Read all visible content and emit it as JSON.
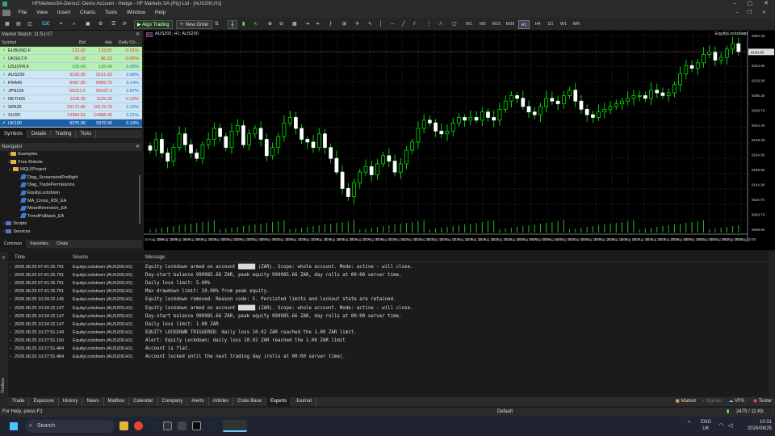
{
  "window": {
    "title": "HFMarketsSA-Demo2: Demo Account - Hedge - HF Markets SA (Pty) Ltd - [AUS200,H1]"
  },
  "menu": [
    "File",
    "View",
    "Insert",
    "Charts",
    "Tools",
    "Window",
    "Help"
  ],
  "toolbar": {
    "algo_trading": "Algo Trading",
    "new_order": "New Order",
    "ide": "IDE",
    "timeframes": [
      "M1",
      "M5",
      "M15",
      "M30",
      "H1",
      "H4",
      "D1",
      "W1",
      "MN"
    ],
    "active_timeframe": "H1"
  },
  "market_watch": {
    "title": "Market Watch: 11:51:07",
    "columns": [
      "Symbol",
      "Bid",
      "Ask",
      "Daily Ch..."
    ],
    "rows": [
      {
        "symbol": "EUBUND.F",
        "bid": "123.82",
        "ask": "123.87",
        "change": "-0.01%",
        "color": "#b6f0b0"
      },
      {
        "symbol": "UKGILT.F",
        "bid": "86.18",
        "ask": "86.23",
        "change": "-0.06%",
        "color": "#b6f0b0"
      },
      {
        "symbol": "US10YR.F",
        "bid": "105.43",
        "ask": "105.49",
        "change": "0.00%",
        "color": "#b6f0b0"
      },
      {
        "symbol": "AUS200",
        "bid": "9150.90",
        "ask": "9161.60",
        "change": "0.68%",
        "color": "#cce6f5"
      },
      {
        "symbol": "FRA40",
        "bid": "8487.80",
        "ask": "8489.70",
        "change": "0.14%",
        "color": "#cce6f5"
      },
      {
        "symbol": "JPN225",
        "bid": "65021.0",
        "ask": "65037.0",
        "change": "0.87%",
        "color": "#cce6f5"
      },
      {
        "symbol": "NETH25",
        "bid": "1108.30",
        "ask": "1109.30",
        "change": "-0.18%",
        "color": "#cce6f5"
      },
      {
        "symbol": "SPA35",
        "bid": "20172.80",
        "ask": "20176.70",
        "change": "0.33%",
        "color": "#cce6f5"
      },
      {
        "symbol": "SUI20",
        "bid": "14484.53",
        "ask": "14488.40",
        "change": "0.21%",
        "color": "#cce6f5"
      },
      {
        "symbol": "UK100",
        "bid": "9375.90",
        "ask": "9376.90",
        "change": "0.19%",
        "color": "#1a5fa8"
      }
    ],
    "tabs": [
      "Symbols",
      "Details",
      "Trading",
      "Ticks"
    ]
  },
  "navigator": {
    "title": "Navigator",
    "items": [
      {
        "label": "Examples",
        "level": 1
      },
      {
        "label": "Free Robots",
        "level": 1
      },
      {
        "label": "MQL5Project",
        "level": 1
      },
      {
        "label": "Diag_ScreenshotPreflight",
        "level": 2
      },
      {
        "label": "Diag_TradePermissions",
        "level": 2
      },
      {
        "label": "EquityLockdown",
        "level": 2
      },
      {
        "label": "MA_Cross_RSI_EA",
        "level": 2
      },
      {
        "label": "MeanReversion_EA",
        "level": 2
      },
      {
        "label": "TrendPullback_EA",
        "level": 2
      },
      {
        "label": "Scripts",
        "level": 0
      },
      {
        "label": "Services",
        "level": 0
      }
    ],
    "tabs": [
      "Common",
      "Favorites",
      "Chats"
    ]
  },
  "chart": {
    "symbol_label": "AUS200, H1: AUS200",
    "indicator_label": "EquityLockdown",
    "price_labels": [
      "9392.30",
      "9369.70",
      "9344.90",
      "9319.90",
      "9295.30",
      "9269.70",
      "9244.30",
      "9219.30",
      "9194.90",
      "9169.90",
      "9144.90",
      "9119.70",
      "9094.70",
      "9069.90"
    ],
    "time_labels": [
      "19 Aug 2026",
      "19 Aug 16:00",
      "19 Aug 18:00",
      "19 Aug 20:00",
      "19 Aug 22:00",
      "20 Aug 00:00",
      "20 Aug 02:00",
      "20 Aug 04:00",
      "20 Aug 06:00",
      "20 Aug 08:00",
      "20 Aug 10:00",
      "20 Aug 12:00",
      "20 Aug 14:00",
      "20 Aug 16:00",
      "20 Aug 18:00",
      "20 Aug 20:00",
      "20 Aug 22:00",
      "21 Aug 00:00",
      "21 Aug 02:00",
      "21 Aug 04:00",
      "21 Aug 06:00",
      "21 Aug 08:00",
      "21 Aug 10:00",
      "21 Aug 12:00",
      "21 Aug 14:00",
      "21 Aug 16:00",
      "21 Aug 18:00",
      "21 Aug 20:00",
      "21 Aug 22:00",
      "24 Aug 00:00",
      "24 Aug 02:00",
      "24 Aug 04:00",
      "24 Aug 06:00",
      "24 Aug 08:00",
      "24 Aug 10:00",
      "24 Aug 12:00",
      "24 Aug 14:00",
      "24 Aug 16:00",
      "24 Aug 18:00",
      "24 Aug 20:00",
      "24 Aug 22:00",
      "25 Aug 00:00",
      "25 Aug 02:00",
      "25 Aug 04:00",
      "25 Aug 06:00",
      "25 Aug 08:00",
      "25 Aug 10:00"
    ],
    "candles_close_trend": [
      9190,
      9210,
      9185,
      9170,
      9195,
      9220,
      9200,
      9185,
      9175,
      9200,
      9210,
      9230,
      9215,
      9195,
      9225,
      9235,
      9200,
      9220,
      9230,
      9210,
      9180,
      9195,
      9215,
      9240,
      9250,
      9230,
      9210,
      9205,
      9195,
      9220,
      9195,
      9175,
      9150,
      9120,
      9105,
      9130,
      9150,
      9160,
      9145,
      9165,
      9180,
      9170,
      9150,
      9165,
      9190,
      9205,
      9230,
      9245,
      9240,
      9225,
      9220,
      9225,
      9240,
      9250,
      9245,
      9250,
      9245,
      9260,
      9250,
      9245,
      9265,
      9280,
      9290,
      9285,
      9270,
      9260,
      9255,
      9270,
      9285,
      9280,
      9275,
      9290,
      9300,
      9280,
      9265,
      9255,
      9250,
      9260,
      9265,
      9270,
      9275,
      9280,
      9285,
      9290,
      9290,
      9285,
      9300,
      9295,
      9290,
      9295,
      9310,
      9330,
      9345,
      9340,
      9350,
      9365,
      9370,
      9355,
      9360,
      9375,
      9385,
      9370
    ]
  },
  "journal": {
    "columns": [
      "Time",
      "Source",
      "Message"
    ],
    "rows": [
      {
        "time": "2026.08.25 07:41:25.791",
        "source": "EquityLockdown (AUS200,H1)",
        "message": "Equity lockdown armed on account ██████ (ZAR). Scope: whole account. Mode: active - will close."
      },
      {
        "time": "2026.08.25 07:41:25.791",
        "source": "EquityLockdown (AUS200,H1)",
        "message": "  Day-start balance 999985.66 ZAR, peak equity 999985.66 ZAR, day rolls at 00:00 server time."
      },
      {
        "time": "2026.08.25 07:41:25.791",
        "source": "EquityLockdown (AUS200,H1)",
        "message": "  Daily loss limit: 5.00%"
      },
      {
        "time": "2026.08.25 07:41:25.791",
        "source": "EquityLockdown (AUS200,H1)",
        "message": "  Max drawdown limit: 10.00% from peak equity."
      },
      {
        "time": "2026.08.25 10:24:22.145",
        "source": "EquityLockdown (AUS200,H1)",
        "message": "Equity lockdown removed. Reason code: 5. Persisted limits and lockout state are retained."
      },
      {
        "time": "2026.08.25 10:24:22.147",
        "source": "EquityLockdown (AUS200,H1)",
        "message": "Equity lockdown armed on account ██████ (ZAR). Scope: whole account. Mode: active - will close."
      },
      {
        "time": "2026.08.25 10:24:22.147",
        "source": "EquityLockdown (AUS200,H1)",
        "message": "  Day-start balance 999985.66 ZAR, peak equity 999985.66 ZAR, day rolls at 00:00 server time."
      },
      {
        "time": "2026.08.25 10:24:22.147",
        "source": "EquityLockdown (AUS200,H1)",
        "message": "  Daily loss limit: 1.00 ZAR"
      },
      {
        "time": "2026.08.25 10:27:51.149",
        "source": "EquityLockdown (AUS200,H1)",
        "message": "EQUITY LOCKDOWN TRIGGERED: daily loss 10.92 ZAR reached the 1.00 ZAR limit."
      },
      {
        "time": "2026.08.25 10:27:51.150",
        "source": "EquityLockdown (AUS200,H1)",
        "message": "Alert: Equity Lockdown: daily loss 10.92 ZAR reached the 1.00 ZAR limit"
      },
      {
        "time": "2026.08.25 10:27:51.484",
        "source": "EquityLockdown (AUS200,H1)",
        "message": "Account is flat."
      },
      {
        "time": "2026.08.25 10:27:51.484",
        "source": "EquityLockdown (AUS200,H1)",
        "message": "Account locked until the next trading day (rolls at 00:00 server time)."
      }
    ]
  },
  "bottom_tabs": [
    "Trade",
    "Exposure",
    "History",
    "News",
    "Mailbox",
    "Calendar",
    "Company",
    "Alerts",
    "Articles",
    "Code Base",
    "Experts",
    "Journal"
  ],
  "bottom_tabs_active": "Experts",
  "bottom_right": {
    "market": "Market",
    "signals": "Signals",
    "vps": "VPS",
    "tester": "Tester"
  },
  "toolbox_label": "Toolbox",
  "status": {
    "help": "For Help, press F1",
    "profile": "Default",
    "traffic": "2475 / 11 Kb"
  },
  "taskbar": {
    "search": "Search",
    "lang": "ENG",
    "region": "UK",
    "time": "10:31",
    "date": "2026/08/25"
  },
  "colors": {
    "bull": "#ffffff",
    "bear": "#ffffff",
    "wick": "#00ff00",
    "accent": "#1a5fa8"
  }
}
